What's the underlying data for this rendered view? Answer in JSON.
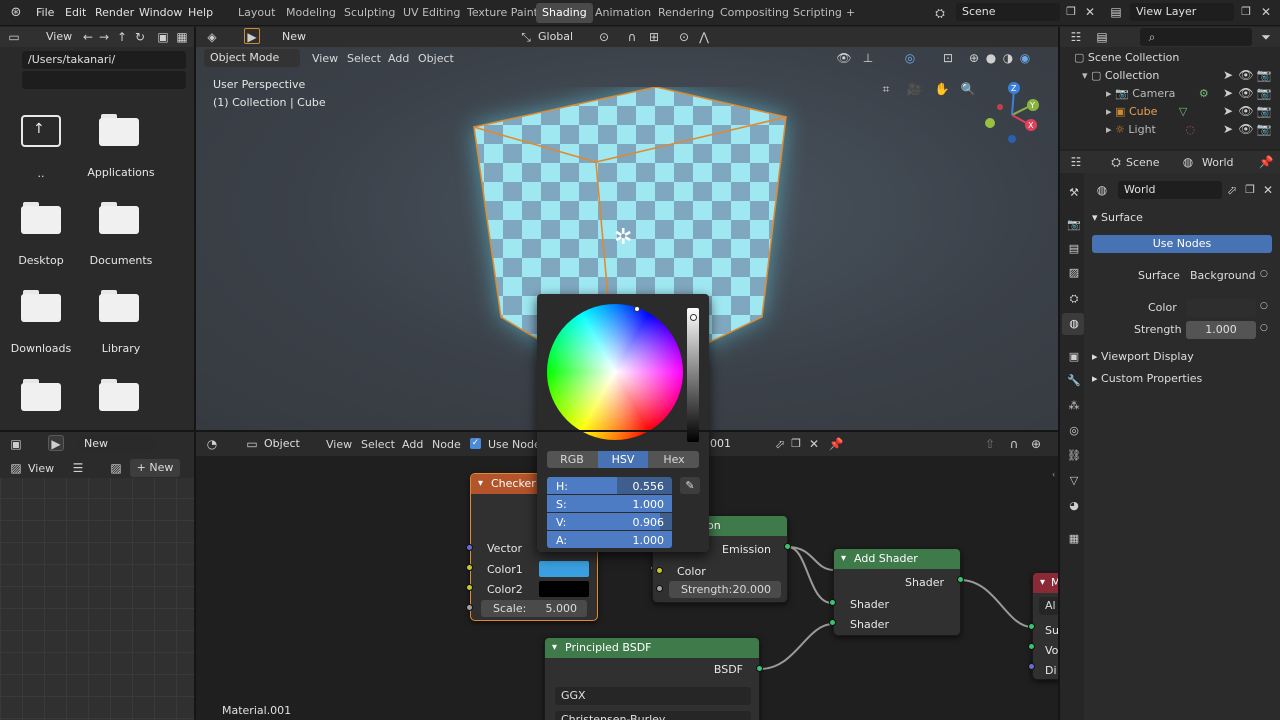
{
  "topbar": {
    "menus": [
      "File",
      "Edit",
      "Render",
      "Window",
      "Help"
    ],
    "workspaces": [
      "Layout",
      "Modeling",
      "Sculpting",
      "UV Editing",
      "Texture Paint",
      "Shading",
      "Animation",
      "Rendering",
      "Compositing",
      "Scripting"
    ],
    "active_workspace": "Shading",
    "add_workspace": "+",
    "scene": "Scene",
    "view_layer": "View Layer"
  },
  "file_browser": {
    "view_label": "View",
    "path": "/Users/takanari/",
    "items": [
      {
        "label": "..",
        "type": "parent"
      },
      {
        "label": "Applications",
        "type": "folder"
      },
      {
        "label": "Desktop",
        "type": "folder"
      },
      {
        "label": "Documents",
        "type": "folder"
      },
      {
        "label": "Downloads",
        "type": "folder"
      },
      {
        "label": "Library",
        "type": "folder"
      },
      {
        "label": "",
        "type": "folder"
      },
      {
        "label": "",
        "type": "folder"
      }
    ]
  },
  "image_editor": {
    "new_label": "New",
    "view_label": "View",
    "new_btn": "+ New"
  },
  "viewport": {
    "new_label": "New",
    "mode": "Object Mode",
    "menu": [
      "View",
      "Select",
      "Add",
      "Object"
    ],
    "transform": "Global",
    "info_line1": "User Perspective",
    "info_line2": "(1) Collection | Cube",
    "gizmo": {
      "x": "X",
      "y": "Y",
      "z": "Z"
    }
  },
  "node_editor": {
    "object_label": "Object",
    "menu": [
      "View",
      "Select",
      "Add",
      "Node"
    ],
    "use_nodes": "Use Nodes",
    "material_field": "001",
    "material_name": "Material.001",
    "nodes": {
      "checker": {
        "title": "Checker Te",
        "vector": "Vector",
        "color1": "Color1",
        "color2": "Color2",
        "scale_label": "Scale:",
        "scale_value": "5.000",
        "color1_hex": "#3a9fe0",
        "color2_hex": "#000000"
      },
      "emission": {
        "title": "on",
        "out": "Emission",
        "color": "Color",
        "strength_label": "Strength:",
        "strength_value": "20.000"
      },
      "add_shader": {
        "title": "Add Shader",
        "out": "Shader",
        "in1": "Shader",
        "in2": "Shader"
      },
      "principled": {
        "title": "Principled BSDF",
        "out": "BSDF",
        "distribution": "GGX",
        "subsurface": "Christensen-Burley"
      },
      "output": {
        "title": "M",
        "target": "Al",
        "s": "Su",
        "v": "Vo",
        "d": "Di"
      }
    }
  },
  "color_picker": {
    "tabs": [
      "RGB",
      "HSV",
      "Hex"
    ],
    "active_tab": "HSV",
    "fields": [
      {
        "label": "H:",
        "value": "0.556",
        "fill": 0.556
      },
      {
        "label": "S:",
        "value": "1.000",
        "fill": 1.0
      },
      {
        "label": "V:",
        "value": "0.906",
        "fill": 0.906
      },
      {
        "label": "A:",
        "value": "1.000",
        "fill": 1.0
      }
    ]
  },
  "outliner": {
    "root": "Scene Collection",
    "collection": "Collection",
    "items": [
      "Camera",
      "Cube",
      "Light"
    ]
  },
  "properties": {
    "scene_tab": "Scene",
    "world_tab": "World",
    "world_name": "World",
    "surface_panel": "Surface",
    "use_nodes_btn": "Use Nodes",
    "surface_label": "Surface",
    "surface_value": "Background",
    "color_label": "Color",
    "strength_label": "Strength",
    "strength_value": "1.000",
    "viewport_display": "Viewport Display",
    "custom_properties": "Custom Properties"
  }
}
